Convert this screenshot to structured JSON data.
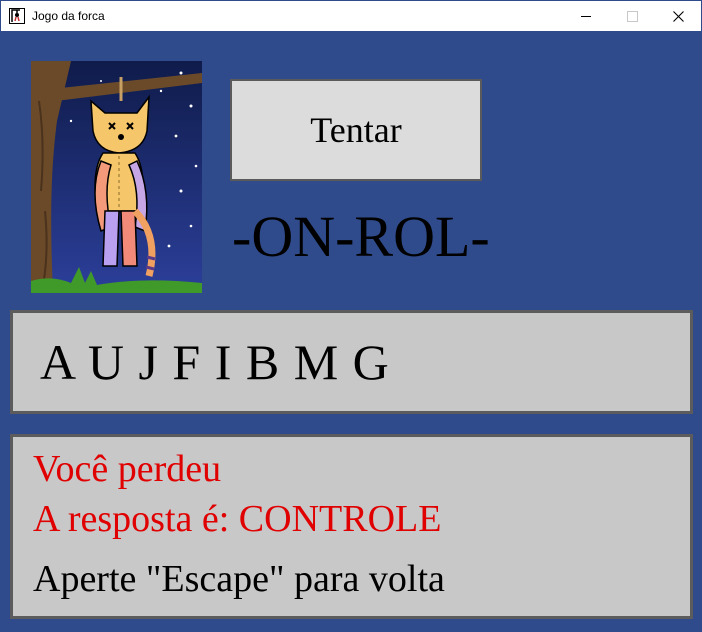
{
  "window": {
    "title": "Jogo da forca",
    "app_icon": "hangman-app-icon",
    "controls": [
      "minimize-icon",
      "maximize-icon",
      "close-icon"
    ]
  },
  "game": {
    "illustration": "hanged-cat-ragdoll-illustration",
    "try_button_label": "Tentar",
    "masked_word": "-ON-ROL-",
    "guessed_letters": "A U J F I B M G",
    "messages": {
      "lost": "Você perdeu",
      "answer": "A resposta é: CONTROLE",
      "hint": "Aperte \"Escape\" para volta"
    }
  },
  "colors": {
    "background": "#2f4b8c",
    "panel": "#c8c8c8",
    "button": "#dcdcdc",
    "error_text": "#e00000"
  }
}
